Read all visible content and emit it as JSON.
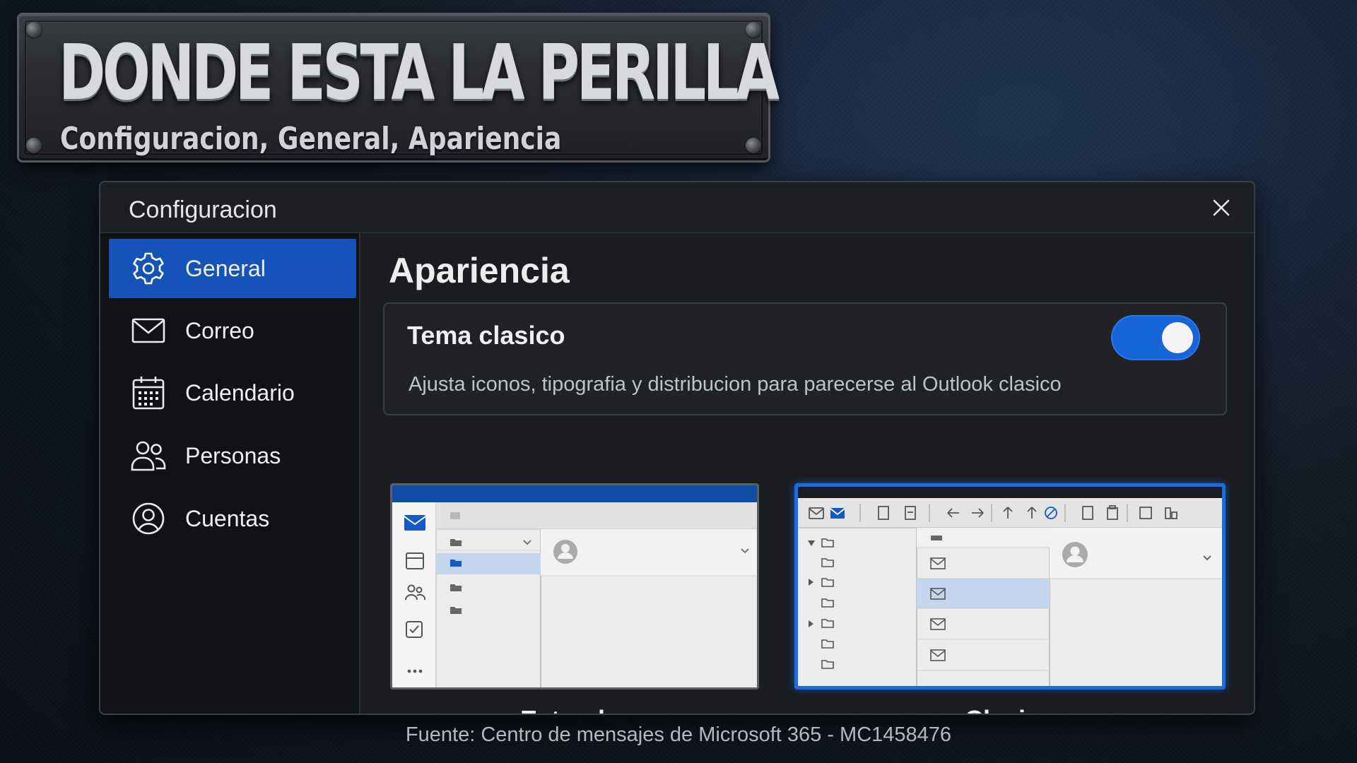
{
  "banner": {
    "title": "DONDE ESTA LA PERILLA",
    "subtitle": "Configuracion, General, Apariencia"
  },
  "dialog": {
    "title": "Configuracion",
    "close_icon": "close-icon"
  },
  "sidebar": {
    "items": [
      {
        "label": "General",
        "icon": "gear-icon",
        "active": true
      },
      {
        "label": "Correo",
        "icon": "mail-icon",
        "active": false
      },
      {
        "label": "Calendario",
        "icon": "calendar-icon",
        "active": false
      },
      {
        "label": "Personas",
        "icon": "people-icon",
        "active": false
      },
      {
        "label": "Cuentas",
        "icon": "account-icon",
        "active": false
      }
    ]
  },
  "main": {
    "section_title": "Apariencia",
    "setting": {
      "title": "Tema clasico",
      "description": "Ajusta iconos, tipografia y distribucion para parecerse al Outlook clasico",
      "enabled": true
    },
    "previews": [
      {
        "label": "Estandar",
        "selected": false
      },
      {
        "label": "Clasico",
        "selected": true
      }
    ]
  },
  "footer": {
    "source": "Fuente: Centro de mensajes de Microsoft 365 - MC1458476"
  },
  "colors": {
    "accent": "#1553b8",
    "toggle_on": "#1664d8",
    "selection_border": "#1a6be6"
  }
}
